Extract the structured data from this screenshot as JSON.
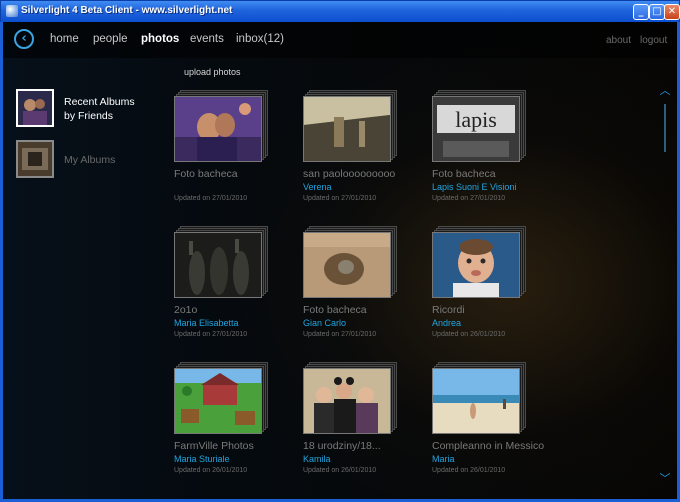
{
  "window": {
    "title": "Silverlight 4 Beta Client - www.silverlight.net",
    "minimize": "_",
    "maximize": "□",
    "close": "✕"
  },
  "nav": {
    "back": "‹",
    "items": [
      "home",
      "people",
      "photos",
      "events",
      "inbox(12)"
    ],
    "active": "photos",
    "about": "about",
    "logout": "logout"
  },
  "upload_label": "upload photos",
  "sidebar": {
    "items": [
      {
        "label_line1": "Recent Albums",
        "label_line2": "by Friends",
        "active": true
      },
      {
        "label_line1": "My Albums",
        "label_line2": "",
        "active": false
      }
    ]
  },
  "albums": [
    {
      "title": "Foto bacheca",
      "owner": "",
      "date": "Updated on 27/01/2010"
    },
    {
      "title": "san paolooooooooo",
      "owner": "Verena",
      "date": "Updated on 27/01/2010"
    },
    {
      "title": "Foto bacheca",
      "owner": "Lapis Suoni E Visioni",
      "date": "Updated on 27/01/2010"
    },
    {
      "title": "2o1o",
      "owner": "Maria Elisabetta",
      "date": "Updated on 27/01/2010"
    },
    {
      "title": "Foto bacheca",
      "owner": "Gian Carlo",
      "date": "Updated on 27/01/2010"
    },
    {
      "title": "Ricordi",
      "owner": "Andrea",
      "date": "Updated on 26/01/2010"
    },
    {
      "title": "FarmVille Photos",
      "owner": "Maria Sturiale",
      "date": "Updated on 26/01/2010"
    },
    {
      "title": "18 urodziny/18...",
      "owner": "Kamila",
      "date": "Updated on 26/01/2010"
    },
    {
      "title": "Compleanno in Messico",
      "owner": "Maria",
      "date": "Updated on 26/01/2010"
    }
  ],
  "photo_caption_text": "lapis",
  "colors": {
    "accent": "#22a5e0",
    "title_bar": "#1f63dc"
  },
  "icons": {
    "back": "back-arrow-icon",
    "scroll_up": "chevron-up-icon",
    "scroll_down": "chevron-down-icon"
  }
}
